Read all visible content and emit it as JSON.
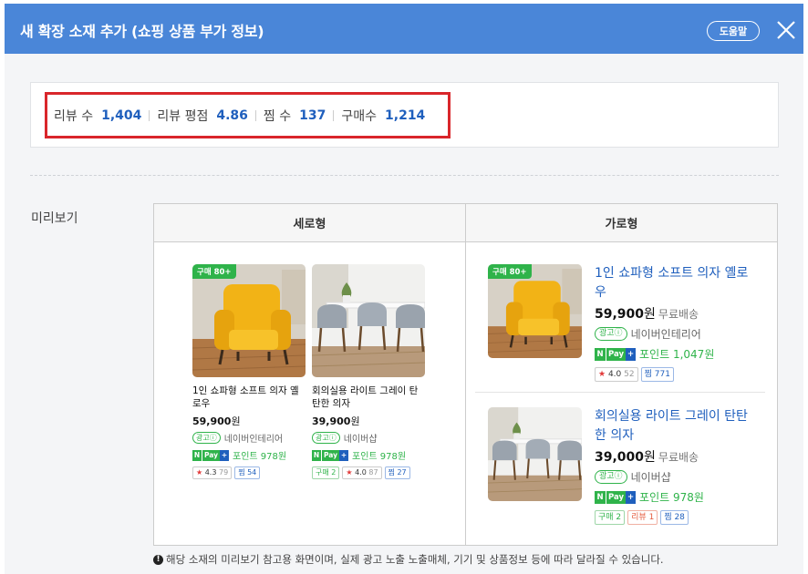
{
  "header": {
    "title": "새 확장 소재 추가 (쇼핑 상품 부가 정보)",
    "help_label": "도움말"
  },
  "stats": [
    {
      "label": "리뷰 수",
      "value": "1,404"
    },
    {
      "label": "리뷰 평점",
      "value": "4.86"
    },
    {
      "label": "찜 수",
      "value": "137"
    },
    {
      "label": "구매수",
      "value": "1,214"
    }
  ],
  "preview": {
    "label": "미리보기",
    "col_vertical": "세로형",
    "col_horizontal": "가로형",
    "vertical": [
      {
        "badge": "구매 80+",
        "name": "1인 쇼파형 소프트 의자 옐로우",
        "price": "59,900",
        "won": "원",
        "ad": "광고ⓘ",
        "seller": "네이버인테리어",
        "points": "포인트 978원",
        "rating": "4.3",
        "rating_count": "79",
        "zzim": "찜 54"
      },
      {
        "name": "회의실용 라이트 그레이 탄탄한 의자",
        "price": "39,900",
        "won": "원",
        "ad": "광고ⓘ",
        "seller": "네이버샵",
        "points": "포인트 978원",
        "buy": "구매 2",
        "rating": "4.0",
        "rating_count": "87",
        "zzim": "찜 27"
      }
    ],
    "horizontal": [
      {
        "badge": "구매 80+",
        "name": "1인 쇼파형 소프트 의자 옐로우",
        "price": "59,900",
        "won": "원",
        "shipping": "무료배송",
        "ad": "광고ⓘ",
        "seller": "네이버인테리어",
        "points": "포인트 1,047원",
        "rating": "4.0",
        "rating_count": "52",
        "zzim": "찜 771"
      },
      {
        "name": "회의실용 라이트 그레이 탄탄한 의자",
        "price": "39,000",
        "won": "원",
        "shipping": "무료배송",
        "ad": "광고ⓘ",
        "seller": "네이버샵",
        "points": "포인트 978원",
        "buy": "구매 2",
        "review": "리뷰 1",
        "zzim": "찜 28"
      }
    ],
    "npay": {
      "n": "N",
      "pay": "Pay",
      "plus": "+"
    }
  },
  "footnote": "해당 소재의 미리보기 참고용 화면이며, 실제 광고 노출 노출매체, 기기 및 상품정보 등에 따라 달라질 수 있습니다.",
  "colors": {
    "header_bg": "#4a86d8",
    "accent_blue": "#1f5fbd",
    "highlight_red": "#d9262b",
    "npay_green": "#2fb34a"
  }
}
